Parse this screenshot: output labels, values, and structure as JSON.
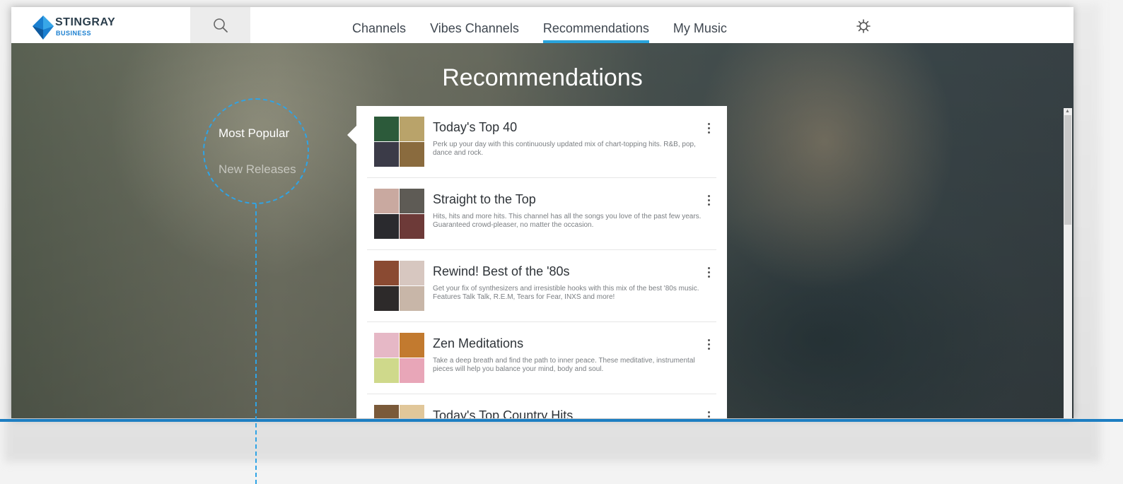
{
  "brand": {
    "name": "STINGRAY",
    "sub": "BUSINESS",
    "colors": {
      "primary": "#2b3e4c",
      "accent": "#1a7fd0",
      "highlight": "#29a3dc"
    }
  },
  "header": {
    "search_icon": "search-icon",
    "settings_icon": "gear-icon",
    "tabs": [
      {
        "label": "Channels",
        "active": false
      },
      {
        "label": "Vibes Channels",
        "active": false
      },
      {
        "label": "Recommendations",
        "active": true
      },
      {
        "label": "My Music",
        "active": false
      }
    ]
  },
  "page": {
    "title": "Recommendations",
    "side_menu": [
      {
        "label": "Most Popular",
        "active": true
      },
      {
        "label": "New Releases",
        "active": false
      }
    ]
  },
  "channels": [
    {
      "title": "Today's Top 40",
      "description": "Perk up your day with this continuously updated mix of chart-topping hits. R&B, pop, dance and rock.",
      "thumb_colors": [
        "#2c5a3a",
        "#b9a36a",
        "#3b3b48",
        "#8a6b3e"
      ]
    },
    {
      "title": "Straight to the Top",
      "description": "Hits, hits and more hits. This channel has all the songs you love of the past few years. Guaranteed crowd-pleaser, no matter the occasion.",
      "thumb_colors": [
        "#c9a9a0",
        "#5e5b55",
        "#2a2a2e",
        "#6d3a38"
      ]
    },
    {
      "title": "Rewind! Best of the '80s",
      "description": "Get your fix of synthesizers and irresistible hooks with this mix of the best '80s music. Features Talk Talk, R.E.M, Tears for Fear, INXS and more!",
      "thumb_colors": [
        "#8a4a32",
        "#d7c7c0",
        "#2d2a2a",
        "#c8b6a8"
      ]
    },
    {
      "title": "Zen Meditations",
      "description": "Take a deep breath and find the path to inner peace. These meditative, instrumental pieces will help you balance your mind, body and soul.",
      "thumb_colors": [
        "#e6b8c6",
        "#c27a2f",
        "#cfd98b",
        "#e8a6b8"
      ]
    },
    {
      "title": "Today's Top Country Hits",
      "description": "",
      "thumb_colors": [
        "#7a5a3a",
        "#e1c79a",
        "#4a3a2a",
        "#d2b08a"
      ]
    }
  ]
}
